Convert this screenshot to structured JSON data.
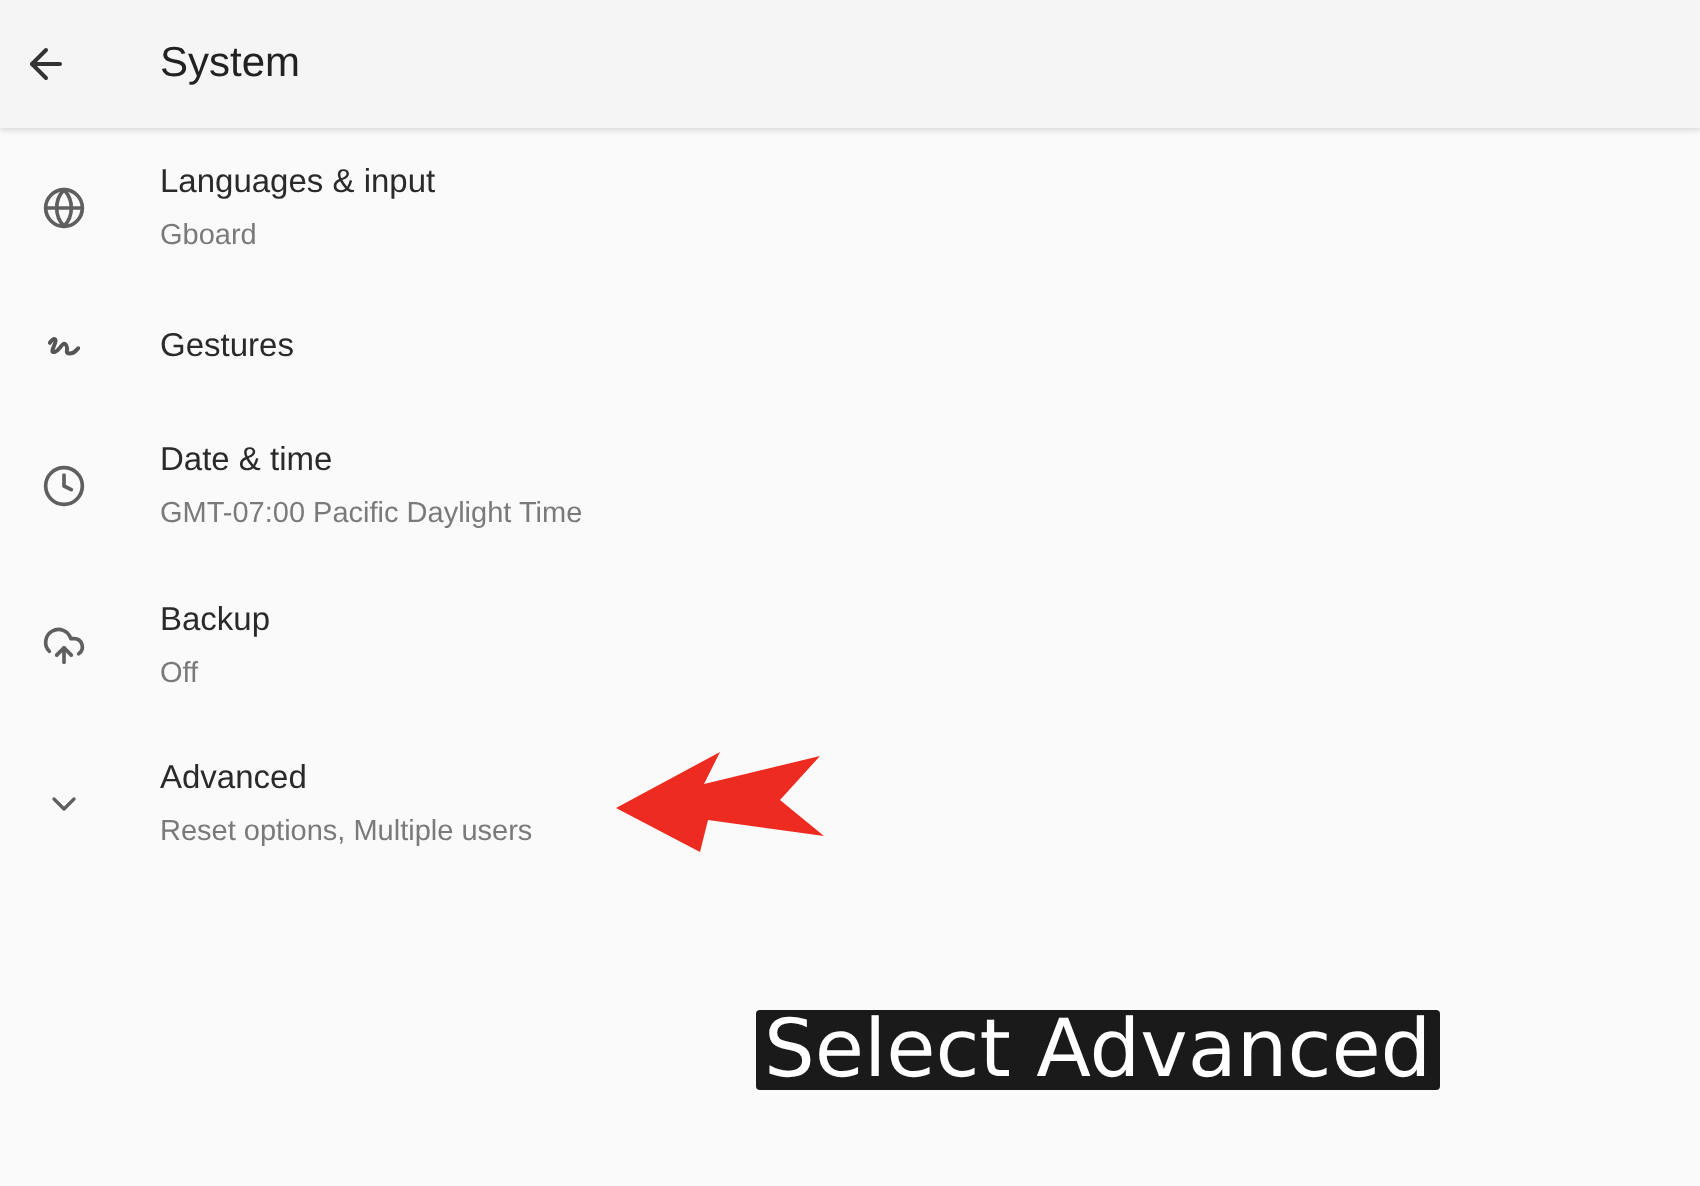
{
  "header": {
    "title": "System"
  },
  "items": [
    {
      "kind": "globe",
      "title": "Languages & input",
      "summary": "Gboard"
    },
    {
      "kind": "gesture",
      "title": "Gestures"
    },
    {
      "kind": "clock",
      "title": "Date & time",
      "summary": "GMT-07:00 Pacific Daylight Time"
    },
    {
      "kind": "cloud",
      "title": "Backup",
      "summary": "Off"
    },
    {
      "kind": "expand",
      "title": "Advanced",
      "summary": "Reset options, Multiple users"
    }
  ],
  "caption": "Select Advanced"
}
